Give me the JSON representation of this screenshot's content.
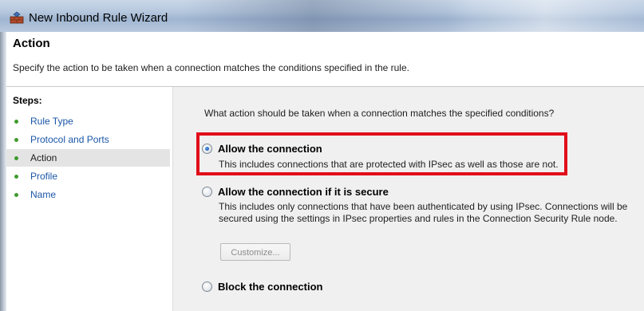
{
  "window": {
    "title": "New Inbound Rule Wizard"
  },
  "header": {
    "title": "Action",
    "description": "Specify the action to be taken when a connection matches the conditions specified in the rule."
  },
  "sidebar": {
    "heading": "Steps:",
    "items": [
      {
        "label": "Rule Type",
        "active": false
      },
      {
        "label": "Protocol and Ports",
        "active": false
      },
      {
        "label": "Action",
        "active": true
      },
      {
        "label": "Profile",
        "active": false
      },
      {
        "label": "Name",
        "active": false
      }
    ]
  },
  "main": {
    "question": "What action should be taken when a connection matches the specified conditions?",
    "options": [
      {
        "label": "Allow the connection",
        "selected": true,
        "description_lines": [
          "This includes connections that are protected with IPsec as well as those are not."
        ]
      },
      {
        "label": "Allow the connection if it is secure",
        "selected": false,
        "description_lines": [
          "This includes only connections that have been authenticated by using IPsec.  Connections will be",
          "secured using the settings in IPsec properties and rules in the Connection Security Rule node."
        ]
      },
      {
        "label": "Block the connection",
        "selected": false,
        "description_lines": []
      }
    ],
    "customize_button": {
      "label": "Customize...",
      "enabled": false
    }
  },
  "colors": {
    "highlight_border": "#e10f1a",
    "link_text": "#1a56a8",
    "step_bullet": "#3f9a2c",
    "active_step_bg": "#e4e4e4",
    "content_bg": "#f0f0f0"
  }
}
